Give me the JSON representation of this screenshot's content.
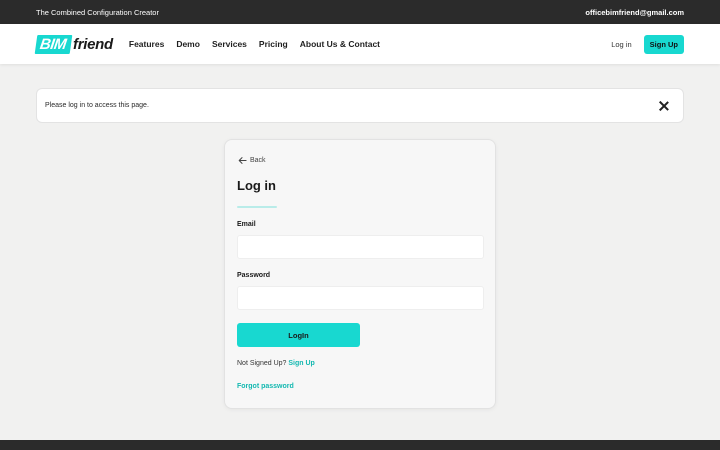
{
  "topbar": {
    "tagline": "The Combined Configuration Creator",
    "email": "officebimfriend@gmail.com"
  },
  "nav": {
    "logo_bim": "BIM",
    "logo_friend": "friend",
    "links": [
      "Features",
      "Demo",
      "Services",
      "Pricing",
      "About Us & Contact"
    ],
    "login_label": "Log in",
    "signup_label": "Sign Up"
  },
  "alert": {
    "message": "Please log in to access this page.",
    "close_icon": "close-icon"
  },
  "login_card": {
    "back_label": "Back",
    "back_icon": "arrow-left-icon",
    "title": "Log in",
    "email_label": "Email",
    "email_value": "",
    "password_label": "Password",
    "password_value": "",
    "submit_label": "LogIn",
    "not_signed_up_text": "Not Signed Up?",
    "signup_link": "Sign Up",
    "forgot_password": "Forgot password"
  },
  "colors": {
    "accent": "#18d8d0",
    "accent_text": "#13b8b0",
    "dark_bar": "#2b2b2b",
    "page_bg": "#f1f1f0"
  }
}
